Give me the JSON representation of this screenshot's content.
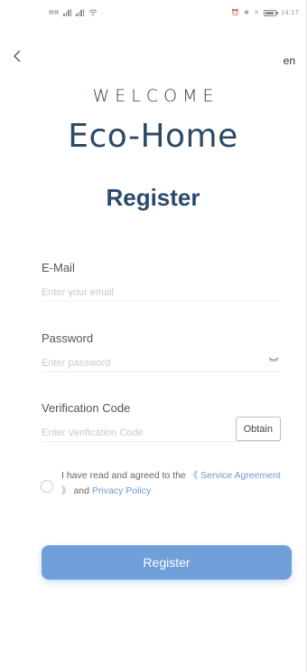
{
  "status_bar": {
    "left_text": "",
    "time": "14:17"
  },
  "header": {
    "language": "en"
  },
  "brand": {
    "welcome": "WELCOME",
    "app_name": "Eco-Home"
  },
  "page": {
    "title": "Register"
  },
  "form": {
    "email": {
      "label": "E-Mail",
      "placeholder": "Enter your email"
    },
    "password": {
      "label": "Password",
      "placeholder": "Enter password"
    },
    "code": {
      "label": "Verification Code",
      "placeholder": "Enter Verification Code",
      "obtain_label": "Obtain"
    }
  },
  "agreement": {
    "prefix": "I have read and agreed to the",
    "service_link": "《 Service Agreement 》",
    "conjunction": "and",
    "privacy_link": "Privacy Policy"
  },
  "submit": {
    "label": "Register"
  },
  "colors": {
    "accent": "#6f9ed9",
    "title": "#2b4a6f",
    "link": "#6b9bd2"
  },
  "icons": {
    "back": "chevron-left-icon",
    "password_toggle": "eye-closed-icon"
  }
}
